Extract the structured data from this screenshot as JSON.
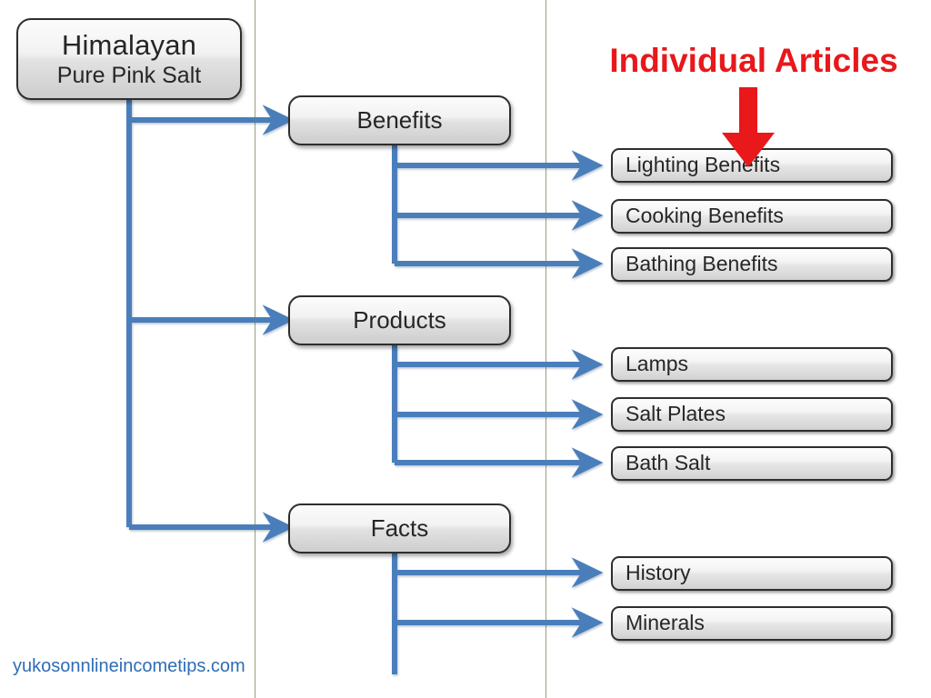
{
  "diagram": {
    "root": {
      "title": "Himalayan",
      "subtitle": "Pure Pink Salt"
    },
    "categories": [
      {
        "id": "benefits",
        "label": "Benefits"
      },
      {
        "id": "products",
        "label": "Products"
      },
      {
        "id": "facts",
        "label": "Facts"
      }
    ],
    "articles": [
      {
        "id": "lighting",
        "label": "Lighting Benefits",
        "parent": "Benefits"
      },
      {
        "id": "cooking",
        "label": "Cooking Benefits",
        "parent": "Benefits"
      },
      {
        "id": "bathing",
        "label": "Bathing Benefits",
        "parent": "Benefits"
      },
      {
        "id": "lamps",
        "label": "Lamps",
        "parent": "Products"
      },
      {
        "id": "plates",
        "label": "Salt Plates",
        "parent": "Products"
      },
      {
        "id": "bath",
        "label": "Bath Salt",
        "parent": "Products"
      },
      {
        "id": "history",
        "label": "History",
        "parent": "Facts"
      },
      {
        "id": "minerals",
        "label": "Minerals",
        "parent": "Facts"
      }
    ]
  },
  "callout": {
    "title": "Individual Articles",
    "arrow_icon": "down-arrow-icon",
    "color": "#e8181b"
  },
  "watermark": {
    "text": "yukosonnlineincometips.com",
    "color": "#2e6cb5"
  },
  "style": {
    "connector_color": "#4a7ebb",
    "guide_line_color": "#8c8c66",
    "node_border_color": "#2e2e2e",
    "node_fill_top": "#fcfcfc",
    "node_fill_bottom": "#cfcfcf",
    "text_color": "#262626"
  }
}
